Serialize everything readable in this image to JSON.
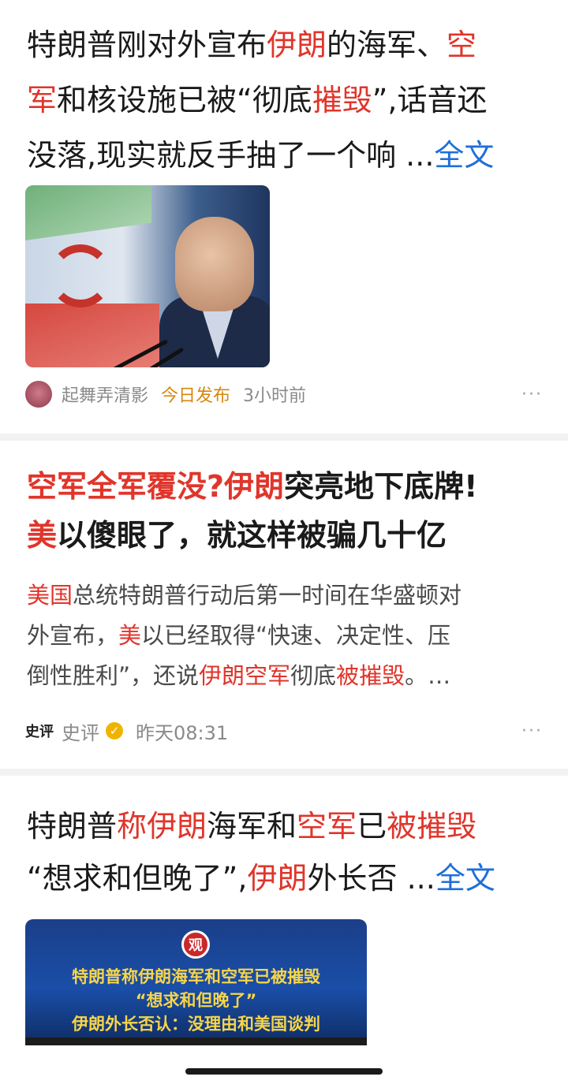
{
  "card1": {
    "title_lines": [
      [
        {
          "t": "特朗普刚对外宣布",
          "hl": false
        },
        {
          "t": "伊朗",
          "hl": true
        },
        {
          "t": "的海军、",
          "hl": false
        },
        {
          "t": "空",
          "hl": true
        }
      ],
      [
        {
          "t": "军",
          "hl": true
        },
        {
          "t": "和核设施已被“彻底",
          "hl": false
        },
        {
          "t": "摧毁",
          "hl": true
        },
        {
          "t": "”,话音还",
          "hl": false
        }
      ],
      [
        {
          "t": "没落,现实就反手抽了一个响 ",
          "hl": false
        }
      ]
    ],
    "ellipsis": "...",
    "fulltext_label": "全文",
    "author": "起舞弄清影",
    "today_label": "今日发布",
    "time": "3小时前",
    "more": "···"
  },
  "card2": {
    "title_lines": [
      [
        {
          "t": "空军全军覆没?",
          "hl": true
        },
        {
          "t": "伊朗",
          "hl": true
        },
        {
          "t": "突亮地下底牌!",
          "hl": false
        }
      ],
      [
        {
          "t": "美",
          "hl": true
        },
        {
          "t": "以傻眼了，就这样被骗几十亿",
          "hl": false
        }
      ]
    ],
    "summary_lines": [
      [
        {
          "t": "美国",
          "hl": true
        },
        {
          "t": "总统特朗普行动后第一时间在华盛顿对",
          "hl": false
        }
      ],
      [
        {
          "t": "外宣布，",
          "hl": false
        },
        {
          "t": "美",
          "hl": true
        },
        {
          "t": "以已经取得“快速、决定性、压",
          "hl": false
        }
      ],
      [
        {
          "t": "倒性胜利”，还说",
          "hl": false
        },
        {
          "t": "伊朗空军",
          "hl": true
        },
        {
          "t": "彻底",
          "hl": false
        },
        {
          "t": "被摧毁",
          "hl": true
        },
        {
          "t": "。…",
          "hl": false
        }
      ]
    ],
    "author_avatar_text": "史评",
    "author": "史评",
    "time": "昨天08:31",
    "more": "···"
  },
  "card3": {
    "title_lines": [
      [
        {
          "t": "特朗普",
          "hl": false
        },
        {
          "t": "称伊朗",
          "hl": true
        },
        {
          "t": "海军和",
          "hl": false
        },
        {
          "t": "空军",
          "hl": true
        },
        {
          "t": "已",
          "hl": false
        },
        {
          "t": "被摧毁",
          "hl": true
        }
      ],
      [
        {
          "t": "“想求和但晚了”,",
          "hl": false
        },
        {
          "t": "伊朗",
          "hl": true
        },
        {
          "t": "外长否 ",
          "hl": false
        }
      ]
    ],
    "ellipsis": "...",
    "fulltext_label": "全文",
    "image_logo": "观",
    "image_lines": [
      "特朗普称伊朗海军和空军已被摧毁",
      "“想求和但晚了”",
      "伊朗外长否认：没理由和美国谈判"
    ]
  },
  "colors": {
    "highlight": "#e0352b",
    "link": "#1e6fd9",
    "today": "#d6870e",
    "banner_text": "#f6d54a"
  }
}
